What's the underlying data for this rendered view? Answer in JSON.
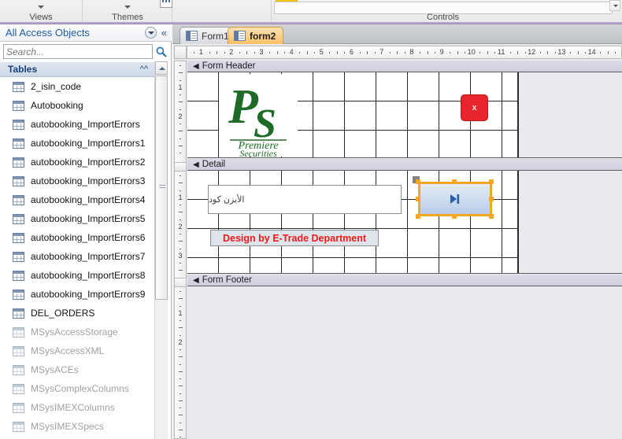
{
  "ribbon": {
    "groups": [
      {
        "label": "Views",
        "icon": "chevron-down-icon"
      },
      {
        "label": "Themes",
        "icon": "chevron-down-icon"
      },
      {
        "label": "Controls",
        "icon": "controls-gallery-icon"
      }
    ],
    "scroll_up_icon": "scroll-up-icon"
  },
  "navpane": {
    "title": "All Access Objects",
    "dropdown_icon": "dropdown-arrow-icon",
    "collapse_icon": "double-chevron-left-icon",
    "search": {
      "placeholder": "Search...",
      "value": "",
      "icon": "search-icon"
    },
    "group": {
      "label": "Tables",
      "collapse_icon": "double-chevron-up-icon"
    },
    "scrollbar": {
      "up_icon": "scroll-up-arrow-icon",
      "thumb": "scrollbar-thumb"
    },
    "items": [
      {
        "label": "2_isin_code",
        "system": false
      },
      {
        "label": "Autobooking",
        "system": false
      },
      {
        "label": "autobooking_ImportErrors",
        "system": false
      },
      {
        "label": "autobooking_ImportErrors1",
        "system": false
      },
      {
        "label": "autobooking_ImportErrors2",
        "system": false
      },
      {
        "label": "autobooking_ImportErrors3",
        "system": false
      },
      {
        "label": "autobooking_ImportErrors4",
        "system": false
      },
      {
        "label": "autobooking_ImportErrors5",
        "system": false
      },
      {
        "label": "autobooking_ImportErrors6",
        "system": false
      },
      {
        "label": "autobooking_ImportErrors7",
        "system": false
      },
      {
        "label": "autobooking_ImportErrors8",
        "system": false
      },
      {
        "label": "autobooking_ImportErrors9",
        "system": false
      },
      {
        "label": "DEL_ORDERS",
        "system": false
      },
      {
        "label": "MSysAccessStorage",
        "system": true
      },
      {
        "label": "MSysAccessXML",
        "system": true
      },
      {
        "label": "MSysACEs",
        "system": true
      },
      {
        "label": "MSysComplexColumns",
        "system": true
      },
      {
        "label": "MSysIMEXColumns",
        "system": true
      },
      {
        "label": "MSysIMEXSpecs",
        "system": true
      }
    ]
  },
  "tabs": [
    {
      "label": "Form1",
      "active": false,
      "icon": "form-icon"
    },
    {
      "label": "form2",
      "active": true,
      "icon": "form-icon"
    }
  ],
  "ruler": {
    "horizontal_ticks": [
      "1",
      "2",
      "3",
      "4",
      "5",
      "6",
      "7",
      "8",
      "9",
      "10",
      "11",
      "12",
      "13",
      "14"
    ],
    "vertical_ticks_header": [
      "1",
      "2"
    ],
    "vertical_ticks_detail": [
      "1",
      "2",
      "3"
    ],
    "vertical_ticks_footer": [
      "1",
      "2"
    ]
  },
  "form": {
    "sections": [
      {
        "name": "Form Header",
        "label": "Form Header",
        "expander_icon": "section-expander-icon"
      },
      {
        "name": "Detail",
        "label": "Detail",
        "expander_icon": "section-expander-icon"
      },
      {
        "name": "Form Footer",
        "label": "Form Footer",
        "expander_icon": "section-expander-icon"
      }
    ],
    "controls": {
      "logo": {
        "name": "premiere-securities-logo",
        "monogram": "PS",
        "line1": "Premiere",
        "line2": "Securities",
        "color": "#1e6b28"
      },
      "close_button": {
        "label": "x",
        "color": "#e8252c",
        "icon": "close-x-icon"
      },
      "isin_textbox": {
        "value": "الأيزن كود",
        "placeholder": ""
      },
      "design_label": {
        "text": "Design by E-Trade Department",
        "color": "#ef1b1b",
        "background": "#dfe3ea"
      },
      "last_record_button": {
        "icon": "go-to-last-record-icon",
        "selected": true,
        "selection_color": "#f5a623"
      }
    }
  }
}
